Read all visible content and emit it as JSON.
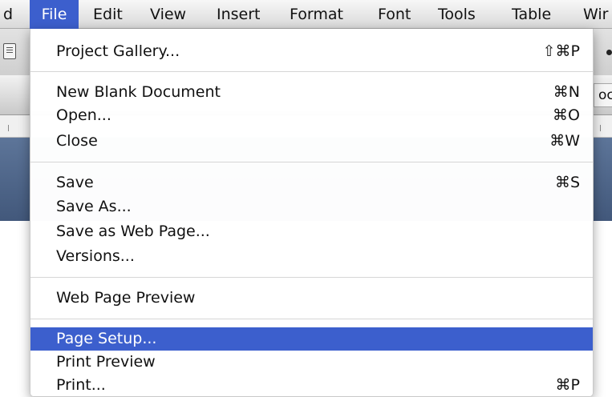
{
  "menubar": {
    "items": [
      {
        "label": "d",
        "active": false
      },
      {
        "label": "File",
        "active": true
      },
      {
        "label": "Edit",
        "active": false
      },
      {
        "label": "View",
        "active": false
      },
      {
        "label": "Insert",
        "active": false
      },
      {
        "label": "Format",
        "active": false
      },
      {
        "label": "Font",
        "active": false
      },
      {
        "label": "Tools",
        "active": false
      },
      {
        "label": "Table",
        "active": false
      },
      {
        "label": "Wir",
        "active": false
      }
    ]
  },
  "background": {
    "ribbon_tab_text": "oc"
  },
  "file_menu": {
    "items": [
      {
        "label": "Project Gallery...",
        "shortcut": "⇧⌘P"
      },
      {
        "label": "New Blank Document",
        "shortcut": "⌘N"
      },
      {
        "label": "Open...",
        "shortcut": "⌘O"
      },
      {
        "label": "Close",
        "shortcut": "⌘W"
      },
      {
        "label": "Save",
        "shortcut": "⌘S"
      },
      {
        "label": "Save As...",
        "shortcut": ""
      },
      {
        "label": "Save as Web Page...",
        "shortcut": ""
      },
      {
        "label": "Versions...",
        "shortcut": ""
      },
      {
        "label": "Web Page Preview",
        "shortcut": ""
      },
      {
        "label": "Page Setup...",
        "shortcut": "",
        "highlighted": true
      },
      {
        "label": "Print Preview",
        "shortcut": ""
      },
      {
        "label": "Print...",
        "shortcut": "⌘P"
      }
    ]
  },
  "colors": {
    "selection": "#3c5fcd",
    "background_band": "#4e6589"
  }
}
